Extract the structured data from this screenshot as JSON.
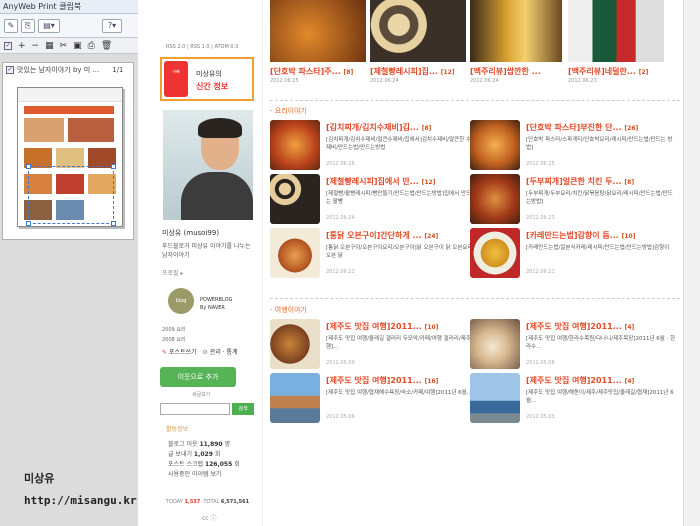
{
  "app": {
    "title": "AnyWeb Print 클립북"
  },
  "clipbook": {
    "item_label": "맛있는 남자이야기 by 미 ...",
    "item_pages": "1/1"
  },
  "brand": {
    "name": "미상유",
    "url": "http://misangu.kr"
  },
  "blog": {
    "rss": "RSS 2.0 | RSS 1.0 | ATOM 0.3",
    "banner_line1": "미상유의",
    "banner_line2": "신간 정보",
    "banner_can": "아빠",
    "profile_name": "미상유 (musoi99)",
    "profile_desc": "푸드블로거 미상유 이야기를 나누는 남자이야기",
    "profile_link": "프로필 ▸",
    "powerblog": "POWERBLOG",
    "by_naver": "By NAVER",
    "pb_year1": "2009 요리",
    "pb_year2": "2008 요리",
    "pb_post": "포스트쓰기",
    "pb_admin": "관리 · 통계",
    "follow": "이웃으로 추가",
    "neighbor": "세글보기",
    "search_button": "검색",
    "activity_title": "활동정보",
    "activity": [
      {
        "label": "블로그 이웃",
        "value": "11,890",
        "unit": "명"
      },
      {
        "label": "글 보내기",
        "value": "1,029",
        "unit": "회"
      },
      {
        "label": "포스트 스크랩",
        "value": "126,055",
        "unit": "회"
      },
      {
        "label": "사용중인 아이템",
        "value": "",
        "unit": "보기"
      }
    ],
    "today_label": "TODAY",
    "today": "1,537",
    "total_label": "TOTAL",
    "total": "6,571,561",
    "cc": "cc ⓘ"
  },
  "top_posts": [
    {
      "title": "[단호박 파스타]주...",
      "num": "[8]",
      "date": "2012.06.25"
    },
    {
      "title": "[제철빵레시피]집...",
      "num": "[12]",
      "date": "2012.06.24"
    },
    {
      "title": "[맥주리뷰]쌉깐한 ...",
      "num": "",
      "date": "2012.06.24"
    },
    {
      "title": "[맥주리뷰]네덜란...",
      "num": "[2]",
      "date": "2012.06.23"
    }
  ],
  "section_cook": "- 요리이야기",
  "cook_posts": [
    {
      "title": "[김치찌개/김치수제비]김...",
      "num": "[8]",
      "summary": "[김치찌개/김치수제비/얼큰수제비/집에서]김치수제비/얼큰한 수제비/만드는법/만드는방법",
      "date": "2012.06.26"
    },
    {
      "title": "[단호박 파스타]부진한 단...",
      "num": "[26]",
      "summary": "[단호박 파스타/스파게티/단호박요리/레시피/만드는법/만드는 방법]",
      "date": "2012.06.25"
    },
    {
      "title": "[제철빵레시피]집에서 만...",
      "num": "[12]",
      "summary": "[제철빵/팥빵레시피/빵만들기/만드는법/만드는방법]집에서 만드는 팥빵",
      "date": "2012.06.24"
    },
    {
      "title": "[두부찌개]얼큰한 치킨 두...",
      "num": "[8]",
      "summary": "[두부찌개/두부요리/치킨/닭볶음탕/닭요리/레시피/만드는법/만드는방법]",
      "date": "2012.06.23"
    },
    {
      "title": "[통닭 오븐구이]간단하게 ...",
      "num": "[24]",
      "summary": "[통닭 오븐구이/오븐구이요리/오븐구이]닭 오븐구이 닭 오븐요리 오븐 닭",
      "date": "2012.06.22"
    },
    {
      "title": "[카레만드는법]감향이 듬...",
      "num": "[10]",
      "summary": "[카레만드는법/일본식카레/레시피/만드는법/만드는방법]감향이",
      "date": "2012.06.21"
    }
  ],
  "section_travel": "- 여행이야기",
  "travel_posts": [
    {
      "title": "[제주도 맛집 여행]2011...",
      "num": "[10]",
      "summary": "[제주도 맛집 여행/올래길 갤러리 두모악/카페/여행 갤러리/제주여행]...",
      "date": "2012.05.09"
    },
    {
      "title": "[제주도 맛집 여행]2011...",
      "num": "[4]",
      "summary": "[제주도 맛집 여행/한라수목원/다나니/제주목장]2011년 6월 · 한라수...",
      "date": "2012.05.08"
    },
    {
      "title": "[제주도 맛집 여행]2011...",
      "num": "[16]",
      "summary": "[제주도 맛집 여행/협재해수욕장/숙소/카페/여행]2011년 6월...",
      "date": "2012.05.06"
    },
    {
      "title": "[제주도 맛집 여행]2011...",
      "num": "[4]",
      "summary": "[제주도 맛집 여행/해돋이/제주/제주맛집/올레길/협재]2011년 6월...",
      "date": "2012.05.03"
    }
  ]
}
